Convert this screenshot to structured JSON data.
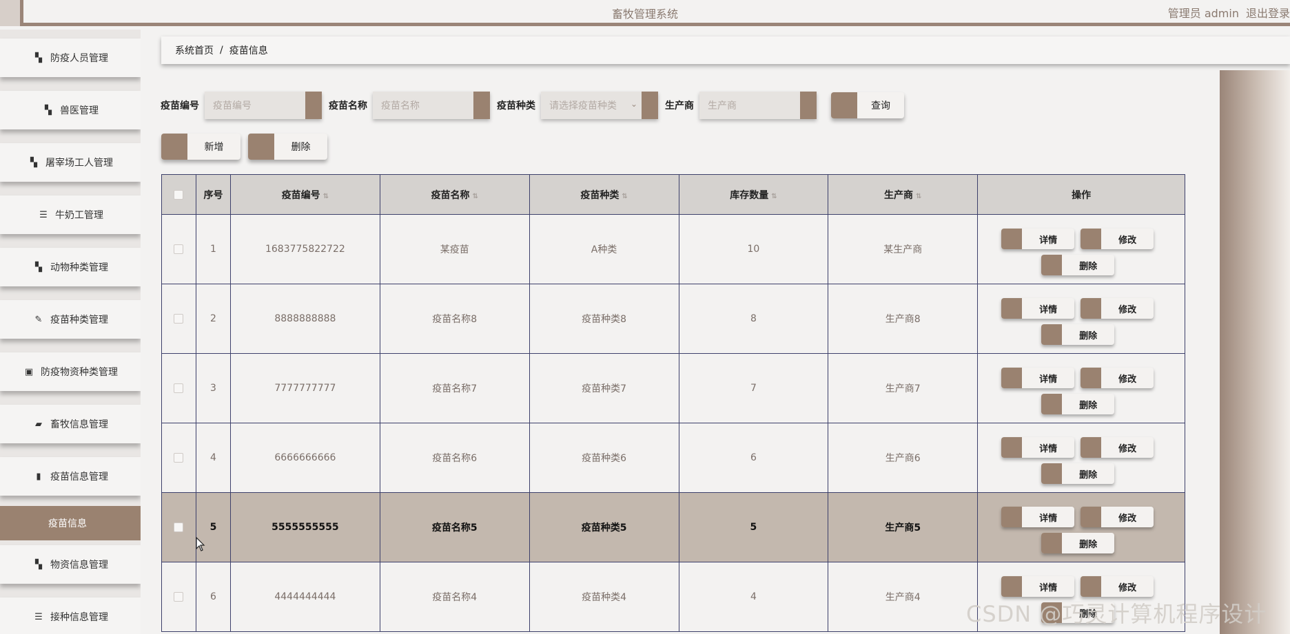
{
  "header": {
    "title": "畜牧管理系统",
    "user": "管理员 admin",
    "logout": "退出登录"
  },
  "sidebar": {
    "items": [
      {
        "label": "防疫人员管理",
        "icon": "grid-icon"
      },
      {
        "label": "兽医管理",
        "icon": "grid-icon"
      },
      {
        "label": "屠宰场工人管理",
        "icon": "grid-icon"
      },
      {
        "label": "牛奶工管理",
        "icon": "list-icon"
      },
      {
        "label": "动物种类管理",
        "icon": "grid-icon"
      },
      {
        "label": "疫苗种类管理",
        "icon": "edit-icon"
      },
      {
        "label": "防疫物资种类管理",
        "icon": "clipboard-icon"
      },
      {
        "label": "畜牧信息管理",
        "icon": "ticket-icon"
      },
      {
        "label": "疫苗信息管理",
        "icon": "bar-chart-icon"
      },
      {
        "label": "物资信息管理",
        "icon": "grid-icon"
      },
      {
        "label": "接种信息管理",
        "icon": "list-icon"
      }
    ],
    "active_sub": "疫苗信息"
  },
  "breadcrumb": {
    "home": "系统首页",
    "sep": "/",
    "current": "疫苗信息"
  },
  "search": {
    "code_label": "疫苗编号",
    "code_placeholder": "疫苗编号",
    "name_label": "疫苗名称",
    "name_placeholder": "疫苗名称",
    "type_label": "疫苗种类",
    "type_placeholder": "请选择疫苗种类",
    "maker_label": "生产商",
    "maker_placeholder": "生产商",
    "query_btn": "查询"
  },
  "actions": {
    "add": "新增",
    "delete": "删除"
  },
  "table": {
    "headers": [
      "序号",
      "疫苗编号",
      "疫苗名称",
      "疫苗种类",
      "库存数量",
      "生产商",
      "操作"
    ],
    "rows": [
      {
        "no": "1",
        "code": "1683775822722",
        "name": "某疫苗",
        "type": "A种类",
        "qty": "10",
        "maker": "某生产商"
      },
      {
        "no": "2",
        "code": "8888888888",
        "name": "疫苗名称8",
        "type": "疫苗种类8",
        "qty": "8",
        "maker": "生产商8"
      },
      {
        "no": "3",
        "code": "7777777777",
        "name": "疫苗名称7",
        "type": "疫苗种类7",
        "qty": "7",
        "maker": "生产商7"
      },
      {
        "no": "4",
        "code": "6666666666",
        "name": "疫苗名称6",
        "type": "疫苗种类6",
        "qty": "6",
        "maker": "生产商6"
      },
      {
        "no": "5",
        "code": "5555555555",
        "name": "疫苗名称5",
        "type": "疫苗种类5",
        "qty": "5",
        "maker": "生产商5"
      },
      {
        "no": "6",
        "code": "4444444444",
        "name": "疫苗名称4",
        "type": "疫苗种类4",
        "qty": "4",
        "maker": "生产商4"
      }
    ],
    "op_labels": {
      "detail": "详情",
      "edit": "修改",
      "delete": "删除"
    }
  },
  "watermark": "CSDN @巧灵计算机程序设计",
  "colors": {
    "accent": "#9a8270",
    "highlight_row": "#c3b8ae",
    "border": "#3c3f6a"
  }
}
